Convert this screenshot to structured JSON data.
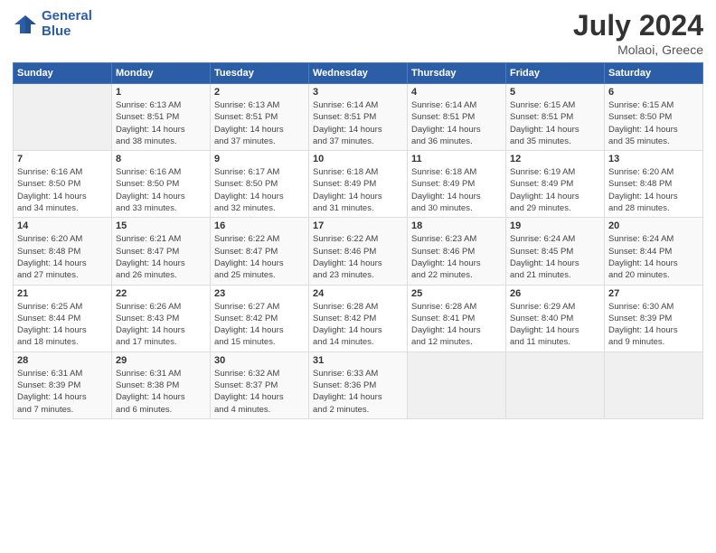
{
  "logo": {
    "line1": "General",
    "line2": "Blue"
  },
  "title": "July 2024",
  "location": "Molaoi, Greece",
  "days_header": [
    "Sunday",
    "Monday",
    "Tuesday",
    "Wednesday",
    "Thursday",
    "Friday",
    "Saturday"
  ],
  "weeks": [
    [
      {
        "day": "",
        "info": ""
      },
      {
        "day": "1",
        "info": "Sunrise: 6:13 AM\nSunset: 8:51 PM\nDaylight: 14 hours\nand 38 minutes."
      },
      {
        "day": "2",
        "info": "Sunrise: 6:13 AM\nSunset: 8:51 PM\nDaylight: 14 hours\nand 37 minutes."
      },
      {
        "day": "3",
        "info": "Sunrise: 6:14 AM\nSunset: 8:51 PM\nDaylight: 14 hours\nand 37 minutes."
      },
      {
        "day": "4",
        "info": "Sunrise: 6:14 AM\nSunset: 8:51 PM\nDaylight: 14 hours\nand 36 minutes."
      },
      {
        "day": "5",
        "info": "Sunrise: 6:15 AM\nSunset: 8:51 PM\nDaylight: 14 hours\nand 35 minutes."
      },
      {
        "day": "6",
        "info": "Sunrise: 6:15 AM\nSunset: 8:50 PM\nDaylight: 14 hours\nand 35 minutes."
      }
    ],
    [
      {
        "day": "7",
        "info": "Sunrise: 6:16 AM\nSunset: 8:50 PM\nDaylight: 14 hours\nand 34 minutes."
      },
      {
        "day": "8",
        "info": "Sunrise: 6:16 AM\nSunset: 8:50 PM\nDaylight: 14 hours\nand 33 minutes."
      },
      {
        "day": "9",
        "info": "Sunrise: 6:17 AM\nSunset: 8:50 PM\nDaylight: 14 hours\nand 32 minutes."
      },
      {
        "day": "10",
        "info": "Sunrise: 6:18 AM\nSunset: 8:49 PM\nDaylight: 14 hours\nand 31 minutes."
      },
      {
        "day": "11",
        "info": "Sunrise: 6:18 AM\nSunset: 8:49 PM\nDaylight: 14 hours\nand 30 minutes."
      },
      {
        "day": "12",
        "info": "Sunrise: 6:19 AM\nSunset: 8:49 PM\nDaylight: 14 hours\nand 29 minutes."
      },
      {
        "day": "13",
        "info": "Sunrise: 6:20 AM\nSunset: 8:48 PM\nDaylight: 14 hours\nand 28 minutes."
      }
    ],
    [
      {
        "day": "14",
        "info": "Sunrise: 6:20 AM\nSunset: 8:48 PM\nDaylight: 14 hours\nand 27 minutes."
      },
      {
        "day": "15",
        "info": "Sunrise: 6:21 AM\nSunset: 8:47 PM\nDaylight: 14 hours\nand 26 minutes."
      },
      {
        "day": "16",
        "info": "Sunrise: 6:22 AM\nSunset: 8:47 PM\nDaylight: 14 hours\nand 25 minutes."
      },
      {
        "day": "17",
        "info": "Sunrise: 6:22 AM\nSunset: 8:46 PM\nDaylight: 14 hours\nand 23 minutes."
      },
      {
        "day": "18",
        "info": "Sunrise: 6:23 AM\nSunset: 8:46 PM\nDaylight: 14 hours\nand 22 minutes."
      },
      {
        "day": "19",
        "info": "Sunrise: 6:24 AM\nSunset: 8:45 PM\nDaylight: 14 hours\nand 21 minutes."
      },
      {
        "day": "20",
        "info": "Sunrise: 6:24 AM\nSunset: 8:44 PM\nDaylight: 14 hours\nand 20 minutes."
      }
    ],
    [
      {
        "day": "21",
        "info": "Sunrise: 6:25 AM\nSunset: 8:44 PM\nDaylight: 14 hours\nand 18 minutes."
      },
      {
        "day": "22",
        "info": "Sunrise: 6:26 AM\nSunset: 8:43 PM\nDaylight: 14 hours\nand 17 minutes."
      },
      {
        "day": "23",
        "info": "Sunrise: 6:27 AM\nSunset: 8:42 PM\nDaylight: 14 hours\nand 15 minutes."
      },
      {
        "day": "24",
        "info": "Sunrise: 6:28 AM\nSunset: 8:42 PM\nDaylight: 14 hours\nand 14 minutes."
      },
      {
        "day": "25",
        "info": "Sunrise: 6:28 AM\nSunset: 8:41 PM\nDaylight: 14 hours\nand 12 minutes."
      },
      {
        "day": "26",
        "info": "Sunrise: 6:29 AM\nSunset: 8:40 PM\nDaylight: 14 hours\nand 11 minutes."
      },
      {
        "day": "27",
        "info": "Sunrise: 6:30 AM\nSunset: 8:39 PM\nDaylight: 14 hours\nand 9 minutes."
      }
    ],
    [
      {
        "day": "28",
        "info": "Sunrise: 6:31 AM\nSunset: 8:39 PM\nDaylight: 14 hours\nand 7 minutes."
      },
      {
        "day": "29",
        "info": "Sunrise: 6:31 AM\nSunset: 8:38 PM\nDaylight: 14 hours\nand 6 minutes."
      },
      {
        "day": "30",
        "info": "Sunrise: 6:32 AM\nSunset: 8:37 PM\nDaylight: 14 hours\nand 4 minutes."
      },
      {
        "day": "31",
        "info": "Sunrise: 6:33 AM\nSunset: 8:36 PM\nDaylight: 14 hours\nand 2 minutes."
      },
      {
        "day": "",
        "info": ""
      },
      {
        "day": "",
        "info": ""
      },
      {
        "day": "",
        "info": ""
      }
    ]
  ]
}
